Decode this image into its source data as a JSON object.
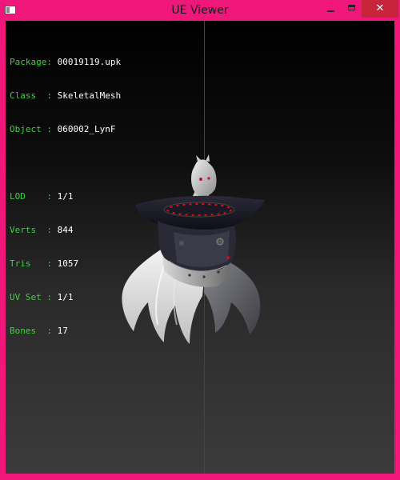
{
  "window": {
    "title": "UE Viewer",
    "controls": {
      "minimize": "minimize",
      "maximize": "maximize",
      "close": "✕"
    }
  },
  "info": {
    "package": {
      "key": "Package:",
      "value": "00019119.upk"
    },
    "class": {
      "key": "Class  :",
      "value": "SkeletalMesh"
    },
    "object": {
      "key": "Object :",
      "value": "060002_LynF"
    },
    "lod": {
      "key": "LOD    :",
      "value": "1/1"
    },
    "verts": {
      "key": "Verts  :",
      "value": "844"
    },
    "tris": {
      "key": "Tris   :",
      "value": "1057"
    },
    "uvset": {
      "key": "UV Set :",
      "value": "1/1"
    },
    "bones": {
      "key": "Bones  :",
      "value": "17"
    }
  },
  "colors": {
    "frame": "#f0177a",
    "label": "#3ad43a",
    "value": "#ffffff",
    "axis": "#1f3bd6",
    "close_button": "#c7263a"
  }
}
